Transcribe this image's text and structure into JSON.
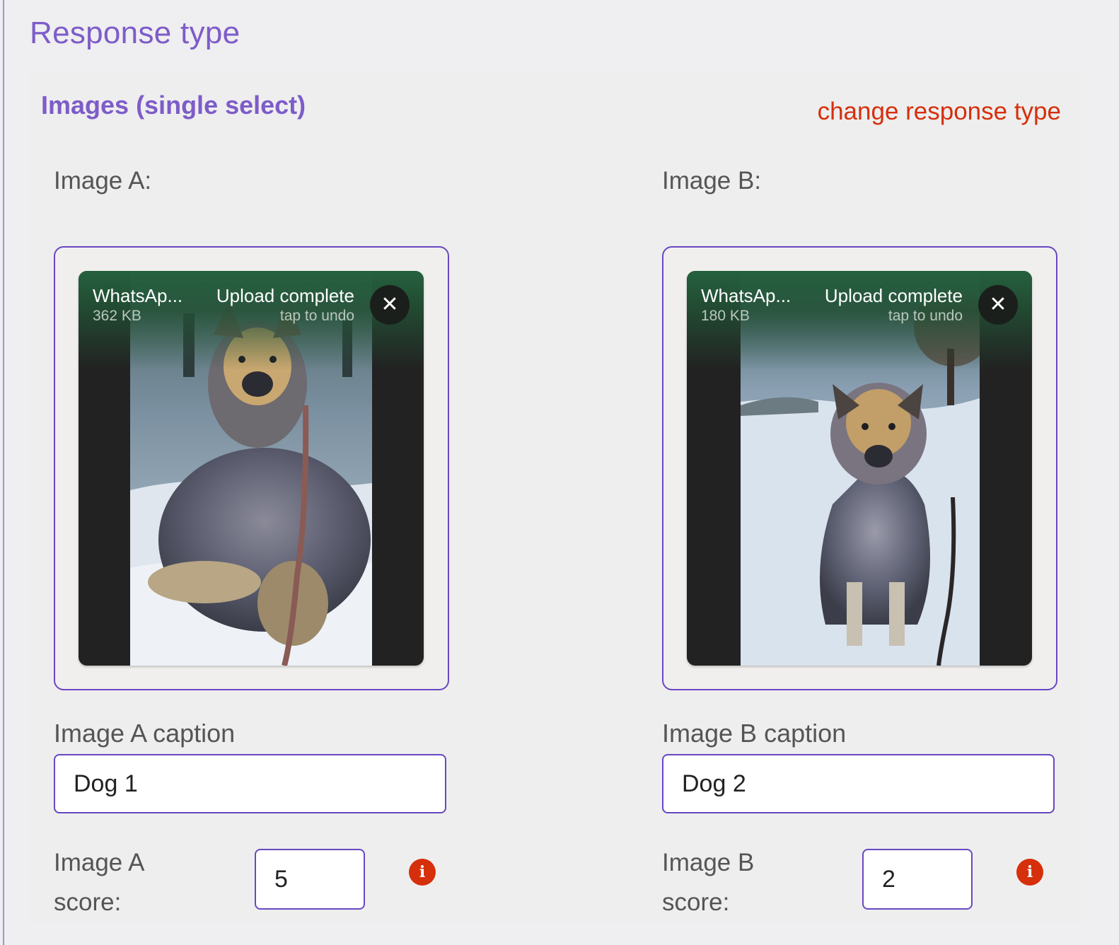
{
  "section": {
    "title": "Response type"
  },
  "panel": {
    "response_type_label": "Images (single select)",
    "change_link": "change response type"
  },
  "images": [
    {
      "label": "Image A:",
      "file_name": "WhatsAp...",
      "file_size": "362 KB",
      "status": "Upload complete",
      "undo_hint": "tap to undo",
      "close_glyph": "✕",
      "caption_label": "Image A caption",
      "caption_value": "Dog 1",
      "score_label": "Image A score:",
      "score_value": "5",
      "info_glyph": "i"
    },
    {
      "label": "Image B:",
      "file_name": "WhatsAp...",
      "file_size": "180 KB",
      "status": "Upload complete",
      "undo_hint": "tap to undo",
      "close_glyph": "✕",
      "caption_label": "Image B caption",
      "caption_value": "Dog 2",
      "score_label": "Image B score:",
      "score_value": "2",
      "info_glyph": "i"
    }
  ],
  "colors": {
    "accent": "#7d5cc9",
    "border": "#6a47c2",
    "link": "#d62f0b",
    "upload_success": "#25613f"
  }
}
